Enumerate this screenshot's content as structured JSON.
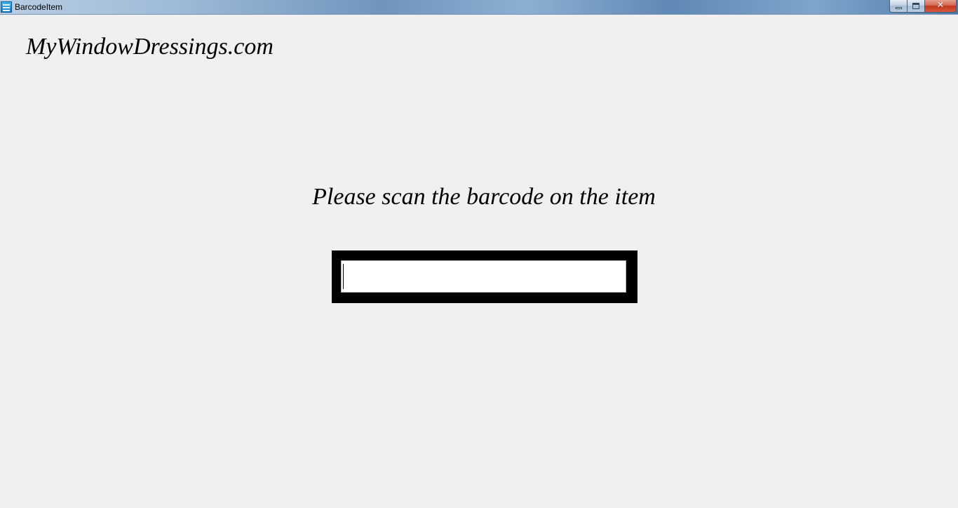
{
  "window": {
    "title": "BarcodeItem",
    "icon": "app-icon",
    "controls": {
      "minimize": "minimize-icon",
      "maximize": "restore-icon",
      "close": "close-icon",
      "close_glyph": "✕"
    }
  },
  "main": {
    "brand": "MyWindowDressings.com",
    "prompt": "Please scan the barcode on the item",
    "barcode_input": {
      "value": "",
      "placeholder": ""
    }
  },
  "colors": {
    "background": "#f0f0f0",
    "input_frame": "#000000",
    "close_button": "#c0371c"
  }
}
